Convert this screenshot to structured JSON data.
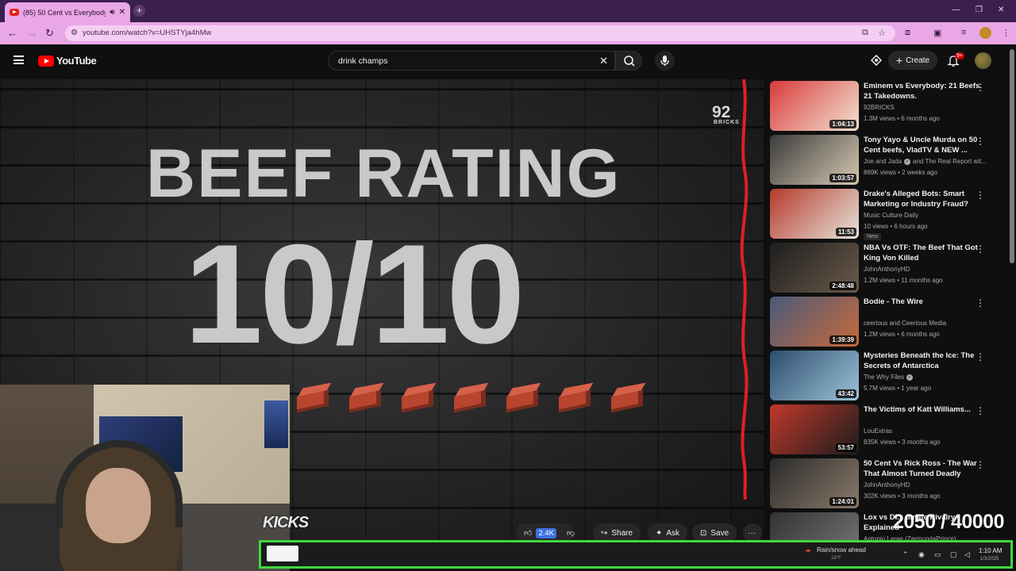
{
  "browser": {
    "tab_title": "(85) 50 Cent vs Everybody",
    "new_tab_label": "+",
    "url": "youtube.com/watch?v=UHSTYja4hMw"
  },
  "youtube": {
    "logo_text": "YouTube",
    "search_value": "drink champs",
    "create_label": "Create",
    "notification_count": "9+"
  },
  "video": {
    "beef_title": "BEEF RATING",
    "beef_score": "10/10",
    "brick_count": 7,
    "watermark_number": "92",
    "watermark_label": "BRICKS",
    "overlay_left": "KICKS",
    "overlay_counter": "2050 / 40000"
  },
  "actions": {
    "like_count": "2.4K",
    "share_label": "Share",
    "ask_label": "Ask",
    "save_label": "Save"
  },
  "recommendations": [
    {
      "title": "Eminem vs Everybody: 21 Beefs. 21 Takedowns.",
      "channel": "92BRICKS",
      "meta": "1.3M views • 6 months ago",
      "duration": "1:04:13",
      "badge": "",
      "verified": false,
      "colors": [
        "#d83a3a",
        "#f2e4d2"
      ]
    },
    {
      "title": "Tony Yayo & Uncle Murda on 50 Cent beefs, VladTV & NEW ...",
      "channel": "Joe and Jada",
      "channel_suffix": "and The Real Report wit...",
      "meta": "869K views • 2 weeks ago",
      "duration": "1:03:57",
      "badge": "",
      "verified": true,
      "colors": [
        "#3b3b3b",
        "#d6c9b2"
      ]
    },
    {
      "title": "Drake's Alleged Bots: Smart Marketing or Industry Fraud?",
      "channel": "Music Culture Daily",
      "meta": "10 views • 6 hours ago",
      "duration": "11:53",
      "badge": "New",
      "verified": false,
      "colors": [
        "#b53a2a",
        "#e8e4dc"
      ]
    },
    {
      "title": "NBA Vs OTF: The Beef That Got King Von Killed",
      "channel": "JohnAnthonyHD",
      "meta": "1.2M views • 11 months ago",
      "duration": "2:48:48",
      "badge": "",
      "verified": false,
      "colors": [
        "#1e1e1e",
        "#6b5a4a"
      ]
    },
    {
      "title": "Bodie - The Wire",
      "channel": "ceerious and Ceerious Media",
      "meta": "1.2M views • 6 months ago",
      "duration": "1:39:39",
      "badge": "",
      "verified": false,
      "colors": [
        "#4a5a7a",
        "#c76a3a"
      ]
    },
    {
      "title": "Mysteries Beneath the Ice: The Secrets of Antarctica",
      "channel": "The Why Files",
      "meta": "5.7M views • 1 year ago",
      "duration": "43:42",
      "badge": "",
      "verified": true,
      "colors": [
        "#2b4d6e",
        "#9fc3d8"
      ]
    },
    {
      "title": "The Victims of Katt Williams...",
      "channel": "LouExtras",
      "meta": "835K views • 3 months ago",
      "duration": "53:57",
      "badge": "",
      "verified": false,
      "colors": [
        "#c0392b",
        "#1c1c1c"
      ]
    },
    {
      "title": "50 Cent Vs Rick Ross - The War That Almost Turned Deadly",
      "channel": "JohnAnthonyHD",
      "meta": "302K views • 3 months ago",
      "duration": "1:24:01",
      "badge": "",
      "verified": false,
      "colors": [
        "#2a2a2a",
        "#8a7a6a"
      ]
    },
    {
      "title": "Lox vs Di... timate Rivalry Explained",
      "channel": "Antonio Larae (ZarmundaPrince)",
      "meta": "",
      "duration": "",
      "badge": "",
      "verified": false,
      "colors": [
        "#333333",
        "#777777"
      ]
    }
  ],
  "taskbar": {
    "weather": "Rain/snow ahead",
    "weather_sub": "18°F",
    "time": "1:10 AM",
    "date": "1/3/2025"
  }
}
